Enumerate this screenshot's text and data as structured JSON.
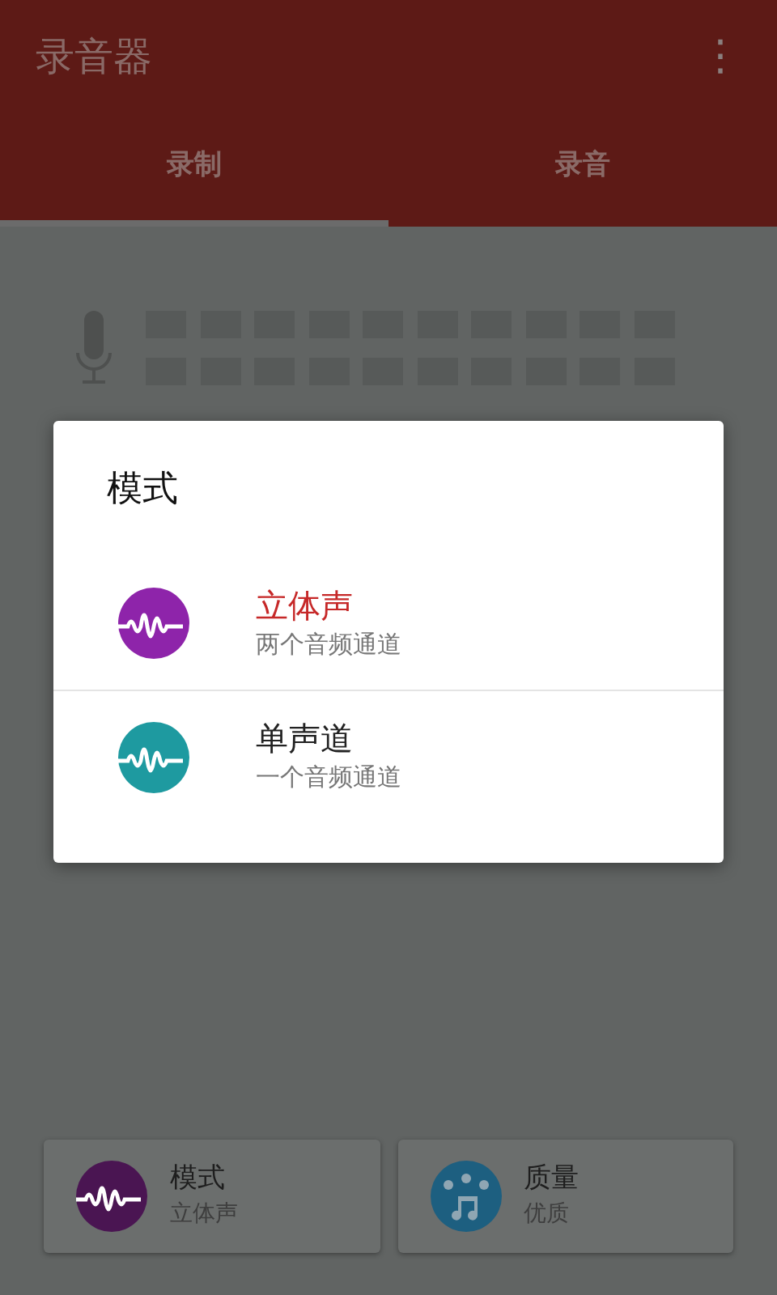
{
  "app_bar": {
    "title": "录音器",
    "menu": "⋮"
  },
  "tabs": [
    {
      "label": "录制",
      "selected": true
    },
    {
      "label": "录音",
      "selected": false
    }
  ],
  "dialog": {
    "title": "模式",
    "options": [
      {
        "label": "立体声",
        "description": "两个音频通道",
        "selected": true,
        "color": "#8e24aa"
      },
      {
        "label": "单声道",
        "description": "一个音频通道",
        "selected": false,
        "color": "#1e9aa0"
      }
    ]
  },
  "settings": [
    {
      "kind": "mode",
      "label": "模式",
      "value": "立体声",
      "color": "#4a1552"
    },
    {
      "kind": "quality",
      "label": "质量",
      "value": "优质",
      "color": "#1d5f80"
    }
  ]
}
